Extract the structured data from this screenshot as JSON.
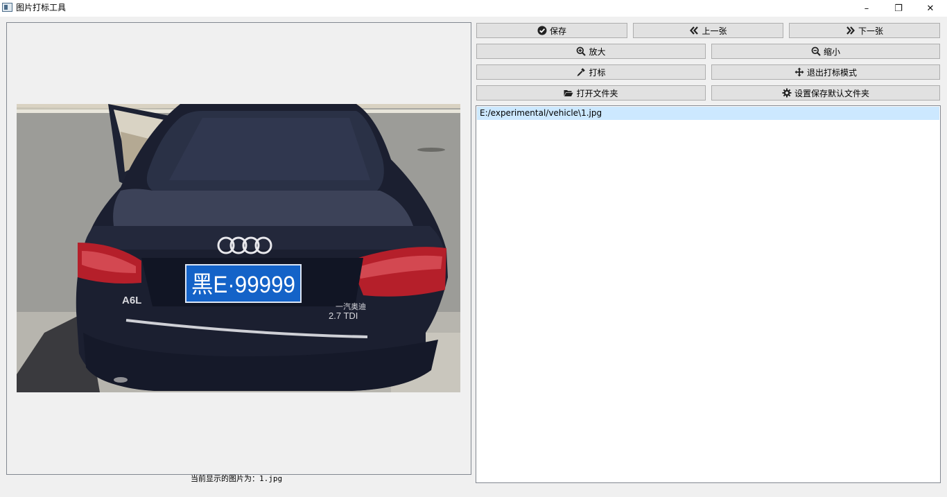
{
  "window": {
    "title": "图片打标工具",
    "controls": {
      "minimize": "–",
      "restore": "❐",
      "close": "✕"
    }
  },
  "toolbar": {
    "save": {
      "label": "保存",
      "icon": "check-circle-icon"
    },
    "prev": {
      "label": "上一张",
      "icon": "angle-double-left-icon"
    },
    "next": {
      "label": "下一张",
      "icon": "angle-double-right-icon"
    },
    "zoom_in": {
      "label": "放大",
      "icon": "zoom-in-icon"
    },
    "zoom_out": {
      "label": "缩小",
      "icon": "zoom-out-icon"
    },
    "annotate": {
      "label": "打标",
      "icon": "eyedropper-icon"
    },
    "exit_annotate": {
      "label": "退出打标模式",
      "icon": "arrows-move-icon"
    },
    "open_folder": {
      "label": "打开文件夹",
      "icon": "folder-open-icon"
    },
    "set_default_folder": {
      "label": "设置保存默认文件夹",
      "icon": "gear-icon"
    }
  },
  "image_view": {
    "photo": {
      "plate_text": "黑E·99999",
      "model_badge": "A6L",
      "brand_badge": "一汽奥迪",
      "engine_badge": "2.7 TDI"
    }
  },
  "status": {
    "current_prefix": "当前显示的图片为：",
    "current_file": "1.jpg"
  },
  "file_list": {
    "items": [
      "E:/experimental/vehicle\\1.jpg"
    ]
  },
  "colors": {
    "button_face": "#e1e1e1",
    "selection": "#cce8ff",
    "car_body": "#1b1f30",
    "plate_blue": "#1463c8"
  }
}
